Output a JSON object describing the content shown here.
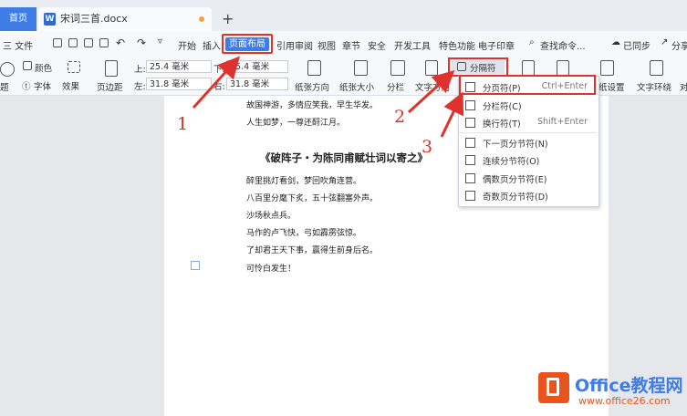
{
  "tabs": {
    "home": "首页",
    "document": "宋词三首.docx",
    "add": "+"
  },
  "menu": {
    "file": "三 文件",
    "items": [
      "开始",
      "插入",
      "页面布局",
      "引用",
      "审阅",
      "视图",
      "章节",
      "安全",
      "开发工具",
      "特色功能",
      "电子印章"
    ],
    "search": "查找命令...",
    "sync": "已同步",
    "share": "分享"
  },
  "ribbon": {
    "theme": "题",
    "colors": "颜色",
    "fonts": "字体",
    "effects": "效果",
    "margins": "页边距",
    "top_label": "上:",
    "top_value": "25.4 毫米",
    "bottom_label": "下:",
    "bottom_value": "25.4 毫米",
    "left_label": "左:",
    "left_value": "31.8 毫米",
    "right_label": "右:",
    "right_value": "31.8 毫米",
    "orientation": "纸张方向",
    "size": "纸张大小",
    "columns": "分栏",
    "text_direction": "文字方向",
    "separator": "分隔符",
    "page_setup": "纸设置",
    "text_wrap": "文字环绕",
    "align": "对"
  },
  "document": {
    "lines_top": [
      "故国神游，多情应笑我，早生华发。",
      "人生如梦，一尊还酹江月。"
    ],
    "poem_title": "《破阵子・为陈同甫赋壮词以寄之》",
    "lines": [
      "醉里挑灯看剑，梦回吹角连营。",
      "八百里分麾下炙，五十弦翻塞外声。",
      "沙场秋点兵。",
      "马作的卢飞快，弓如霹雳弦惊。",
      "了却君王天下事，赢得生前身后名。",
      "可怜白发生！"
    ]
  },
  "dropdown": {
    "items": [
      {
        "label": "分页符(P)",
        "shortcut": "Ctrl+Enter"
      },
      {
        "label": "分栏符(C)",
        "shortcut": ""
      },
      {
        "label": "换行符(T)",
        "shortcut": "Shift+Enter"
      },
      {
        "label": "下一页分节符(N)",
        "shortcut": ""
      },
      {
        "label": "连续分节符(O)",
        "shortcut": ""
      },
      {
        "label": "偶数页分节符(E)",
        "shortcut": ""
      },
      {
        "label": "奇数页分节符(D)",
        "shortcut": ""
      }
    ]
  },
  "annotations": {
    "one": "1",
    "two": "2",
    "three": "3"
  },
  "watermark": {
    "brand": "Office教程网",
    "url": "www.office26.com"
  },
  "colors": {
    "accent": "#3e7ce6",
    "annotation": "#e0322d",
    "watermark_orange": "#e8541c"
  }
}
